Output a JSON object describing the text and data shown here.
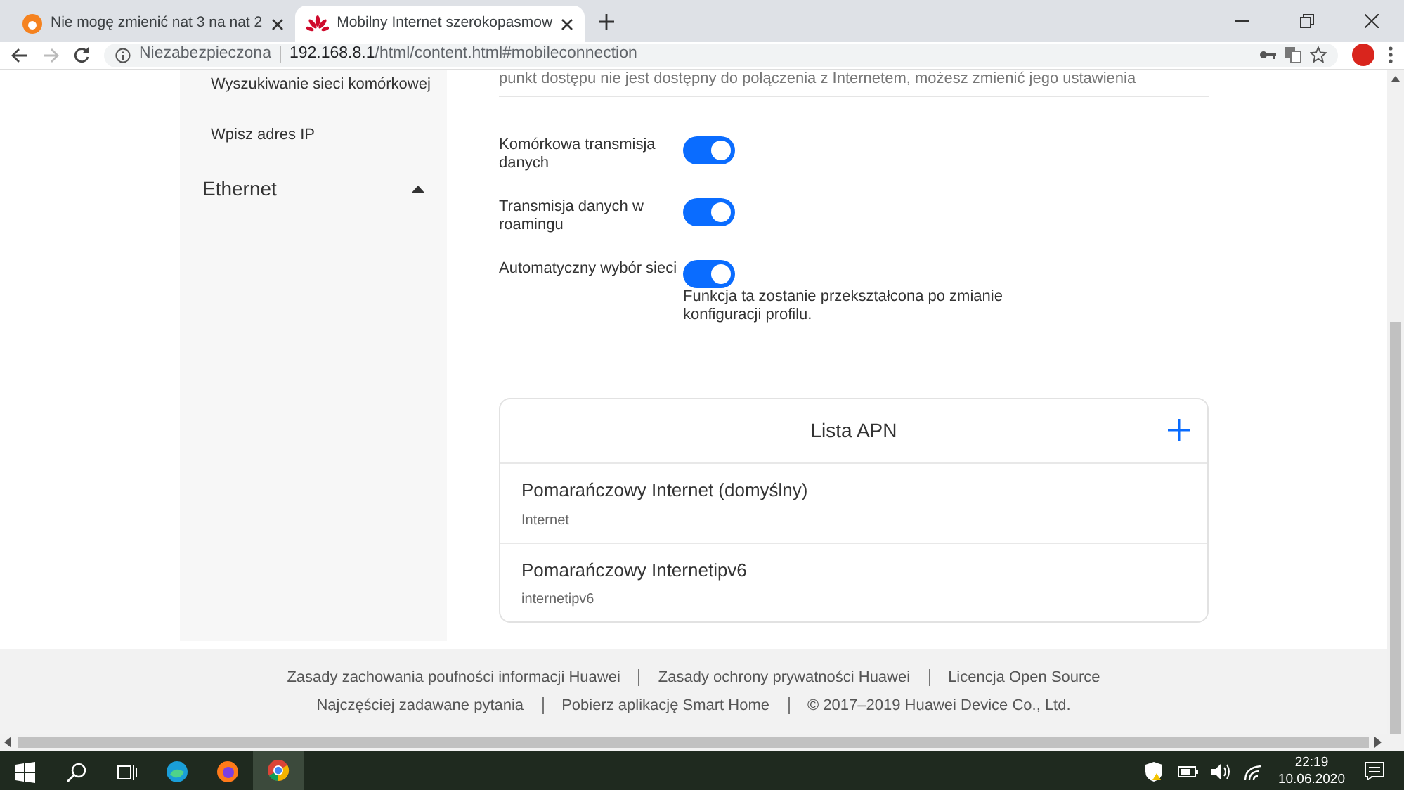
{
  "browser": {
    "tabs": [
      {
        "title": "Nie mogę zmienić nat 3 na nat 2",
        "selected": false,
        "kind": "forum"
      },
      {
        "title": "Mobilny Internet szerokopasmow",
        "selected": true,
        "kind": "router"
      }
    ],
    "address": {
      "security_label": "Niezabezpieczona",
      "host": "192.168.8.1",
      "path": "/html/content.html#mobileconnection"
    }
  },
  "sidebar": {
    "items": [
      {
        "label": "Wyszukiwanie sieci komórkowej",
        "kind": "subitem"
      },
      {
        "label": "Wpisz adres IP",
        "kind": "subitem"
      },
      {
        "label": "Ethernet",
        "kind": "section",
        "expanded": true
      }
    ]
  },
  "intro_text": "punkt dostępu nie jest dostępny do połączenia z Internetem, możesz zmienić jego ustawienia",
  "settings": [
    {
      "label": "Komórkowa transmisja danych",
      "on": true
    },
    {
      "label": "Transmisja danych w roamingu",
      "on": true
    },
    {
      "label": "Automatyczny wybór sieci",
      "on": true,
      "note": "Funkcja ta zostanie przekształcona po zmianie konfiguracji profilu."
    }
  ],
  "apn_list": {
    "title": "Lista APN",
    "items": [
      {
        "name": "Pomarańczowy Internet (domyślny)",
        "apn": "Internet"
      },
      {
        "name": "Pomarańczowy Internetipv6",
        "apn": "internetipv6"
      }
    ]
  },
  "footer": {
    "rows": [
      [
        "Zasady zachowania poufności informacji Huawei",
        "Zasady ochrony prywatności Huawei",
        "Licencja Open Source"
      ],
      [
        "Najczęściej zadawane pytania",
        "Pobierz aplikację Smart Home",
        "© 2017–2019 Huawei Device Co., Ltd."
      ]
    ]
  },
  "taskbar": {
    "time": "22:19",
    "date": "10.06.2020"
  }
}
